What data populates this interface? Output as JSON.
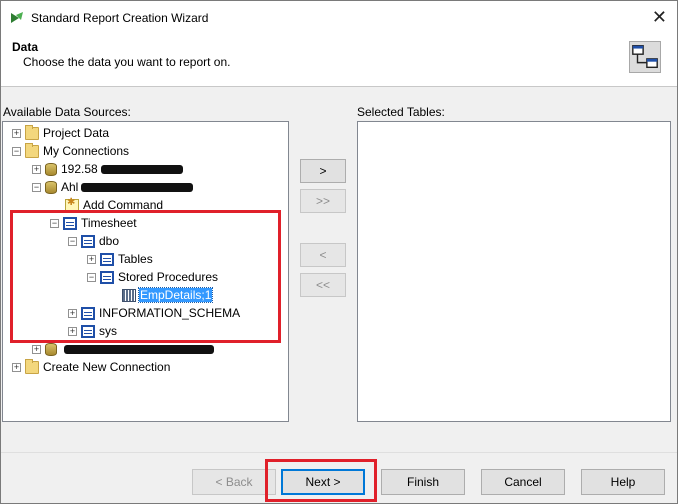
{
  "window": {
    "title": "Standard Report Creation Wizard",
    "close": "✕"
  },
  "header": {
    "title": "Data",
    "subtitle": "Choose the data you want to report on."
  },
  "available": {
    "label": "Available Data Sources:",
    "items": [
      {
        "label": "Project Data"
      },
      {
        "label": "My Connections"
      },
      {
        "label": "192.58"
      },
      {
        "label": "Ahl"
      },
      {
        "label": "Add Command"
      },
      {
        "label": "Timesheet"
      },
      {
        "label": "dbo"
      },
      {
        "label": "Tables"
      },
      {
        "label": "Stored Procedures"
      },
      {
        "label": "EmpDetails;1"
      },
      {
        "label": "INFORMATION_SCHEMA"
      },
      {
        "label": "sys"
      },
      {
        "label": ""
      },
      {
        "label": "Create New Connection"
      }
    ]
  },
  "selected": {
    "label": "Selected Tables:"
  },
  "transfer": {
    "add": ">",
    "add_all": ">>",
    "remove": "<",
    "remove_all": "<<"
  },
  "footer": {
    "back": "< Back",
    "next": "Next >",
    "finish": "Finish",
    "cancel": "Cancel",
    "help": "Help"
  },
  "colors": {
    "highlight": "#e0202a",
    "selection": "#3399ff"
  }
}
